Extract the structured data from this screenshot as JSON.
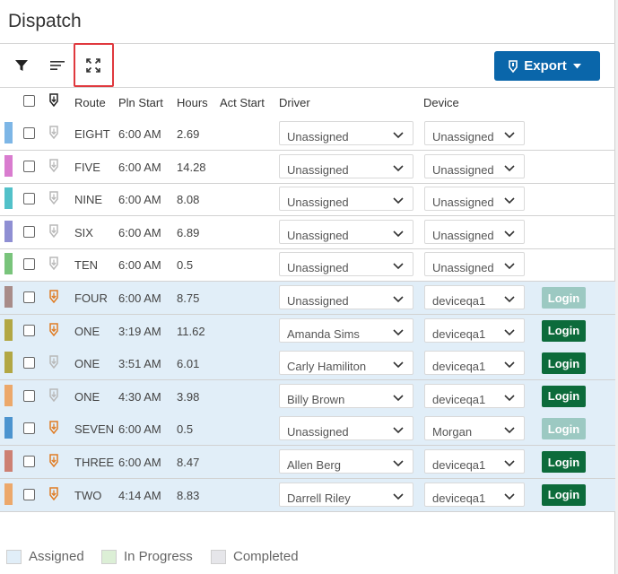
{
  "window": {
    "title": "Dispatch"
  },
  "toolbar": {
    "filter_icon": "filter-icon",
    "sort_icon": "sort-lines-icon",
    "fullscreen_icon": "expand-icon",
    "export_label": "Export"
  },
  "columns": {
    "route": "Route",
    "pln_start": "Pln Start",
    "hours": "Hours",
    "act_start": "Act Start",
    "driver": "Driver",
    "device": "Device"
  },
  "rows": [
    {
      "color": "#7db6e6",
      "route": "EIGHT",
      "pln_start": "6:00 AM",
      "hours": "2.69",
      "driver": "Unassigned",
      "device": "Unassigned",
      "assigned": false,
      "device_icon_active": false,
      "login": null
    },
    {
      "color": "#d97ccf",
      "route": "FIVE",
      "pln_start": "6:00 AM",
      "hours": "14.28",
      "driver": "Unassigned",
      "device": "Unassigned",
      "assigned": false,
      "device_icon_active": false,
      "login": null
    },
    {
      "color": "#52c1c9",
      "route": "NINE",
      "pln_start": "6:00 AM",
      "hours": "8.08",
      "driver": "Unassigned",
      "device": "Unassigned",
      "assigned": false,
      "device_icon_active": false,
      "login": null
    },
    {
      "color": "#8f8fd3",
      "route": "SIX",
      "pln_start": "6:00 AM",
      "hours": "6.89",
      "driver": "Unassigned",
      "device": "Unassigned",
      "assigned": false,
      "device_icon_active": false,
      "login": null
    },
    {
      "color": "#79c47b",
      "route": "TEN",
      "pln_start": "6:00 AM",
      "hours": "0.5",
      "driver": "Unassigned",
      "device": "Unassigned",
      "assigned": false,
      "device_icon_active": false,
      "login": null
    },
    {
      "color": "#a88c89",
      "route": "FOUR",
      "pln_start": "6:00 AM",
      "hours": "8.75",
      "driver": "Unassigned",
      "device": "deviceqa1",
      "assigned": true,
      "device_icon_active": true,
      "login": "disabled"
    },
    {
      "color": "#b2a744",
      "route": "ONE",
      "pln_start": "3:19 AM",
      "hours": "11.62",
      "driver": "Amanda Sims",
      "device": "deviceqa1",
      "assigned": true,
      "device_icon_active": true,
      "login": "enabled"
    },
    {
      "color": "#b2a744",
      "route": "ONE",
      "pln_start": "3:51 AM",
      "hours": "6.01",
      "driver": "Carly Hamiliton",
      "device": "deviceqa1",
      "assigned": true,
      "device_icon_active": false,
      "login": "enabled"
    },
    {
      "color": "#eca86b",
      "route": "ONE",
      "pln_start": "4:30 AM",
      "hours": "3.98",
      "driver": "Billy Brown",
      "device": "deviceqa1",
      "assigned": true,
      "device_icon_active": false,
      "login": "enabled"
    },
    {
      "color": "#4c94cf",
      "route": "SEVEN",
      "pln_start": "6:00 AM",
      "hours": "0.5",
      "driver": "Unassigned",
      "device": "Morgan",
      "assigned": true,
      "device_icon_active": true,
      "login": "disabled"
    },
    {
      "color": "#cd8073",
      "route": "THREE",
      "pln_start": "6:00 AM",
      "hours": "8.47",
      "driver": "Allen Berg",
      "device": "deviceqa1",
      "assigned": true,
      "device_icon_active": true,
      "login": "enabled"
    },
    {
      "color": "#eca86b",
      "route": "TWO",
      "pln_start": "4:14 AM",
      "hours": "8.83",
      "driver": "Darrell Riley",
      "device": "deviceqa1",
      "assigned": true,
      "device_icon_active": true,
      "login": "enabled"
    }
  ],
  "login_label": "Login",
  "legend": [
    {
      "label": "Assigned",
      "color": "#e1eef8"
    },
    {
      "label": "In Progress",
      "color": "#dcefd6"
    },
    {
      "label": "Completed",
      "color": "#e6e6ea"
    }
  ]
}
